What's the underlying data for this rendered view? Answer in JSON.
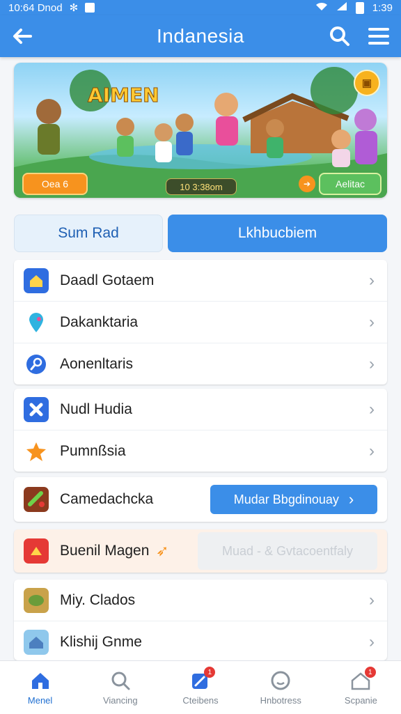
{
  "status": {
    "time_left": "10:64 Dnod",
    "time_right": "1:39"
  },
  "appbar": {
    "title": "Indanesia"
  },
  "banner": {
    "title": "AIMEN",
    "left_pill": "Oea 6",
    "center_pill": "10 3:38om",
    "right_pill": "Aelitac"
  },
  "segments": {
    "left": "Sum Rad",
    "right": "Lkhbucbiem"
  },
  "group1": [
    {
      "label": "Daadl Gotaem",
      "icon": "home-icon",
      "color": "#2f6de0"
    },
    {
      "label": "Dakanktaria",
      "icon": "pin-icon",
      "color": "#2fb3e0"
    },
    {
      "label": "Aonenltaris",
      "icon": "search-icon",
      "color": "#2f6de0"
    }
  ],
  "group2": [
    {
      "label": "Nudl Hudia",
      "icon": "puzzle-icon",
      "color": "#2f6de0"
    },
    {
      "label": "Pumnßsia",
      "icon": "star-icon",
      "color": "#f7931e"
    }
  ],
  "promo1": {
    "label": "Camedachcka",
    "button": "Mudar Bbgdinouay"
  },
  "promo2": {
    "label": "Buenil Magen",
    "button": "Muad - & Gvtacoentfaly"
  },
  "group3": [
    {
      "label": "Miy. Clados",
      "icon": "game-icon"
    },
    {
      "label": "Klishij Gnme",
      "icon": "house-icon"
    }
  ],
  "nav": [
    {
      "label": "Menel",
      "icon": "home-nav-icon"
    },
    {
      "label": "Viancing",
      "icon": "search-nav-icon"
    },
    {
      "label": "Cteibens",
      "icon": "edit-nav-icon",
      "badge": "1"
    },
    {
      "label": "Hnbotress",
      "icon": "face-nav-icon"
    },
    {
      "label": "Scpanie",
      "icon": "share-nav-icon",
      "badge": "1"
    }
  ],
  "colors": {
    "primary": "#3b8ee8",
    "accent_orange": "#f7931e"
  }
}
